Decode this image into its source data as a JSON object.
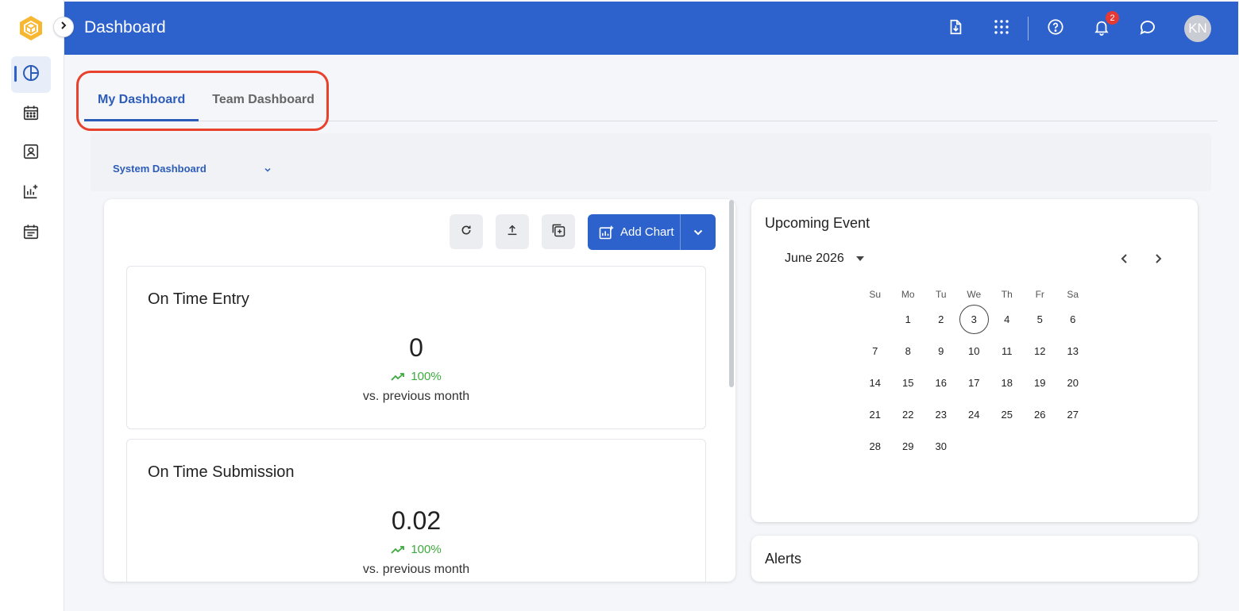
{
  "header": {
    "title": "Dashboard",
    "notification_count": "2",
    "avatar_initials": "KN",
    "color": "#2d62cc"
  },
  "sidebar": {
    "items": [
      {
        "icon": "dashboard-pie-icon",
        "active": true
      },
      {
        "icon": "calendar-icon",
        "active": false
      },
      {
        "icon": "user-card-icon",
        "active": false
      },
      {
        "icon": "chart-add-icon",
        "active": false
      },
      {
        "icon": "schedule-icon",
        "active": false
      }
    ]
  },
  "tabs": [
    {
      "label": "My Dashboard",
      "active": true
    },
    {
      "label": "Team Dashboard",
      "active": false
    }
  ],
  "dashboard_selector": {
    "value": "System Dashboard"
  },
  "toolbar": {
    "add_chart_label": "Add Chart"
  },
  "metrics": [
    {
      "title": "On Time Entry",
      "value": "0",
      "trend": "100%",
      "compare": "vs. previous month"
    },
    {
      "title": "On Time Submission",
      "value": "0.02",
      "trend": "100%",
      "compare": "vs. previous month"
    }
  ],
  "upcoming_event": {
    "title": "Upcoming Event",
    "month": "June 2026",
    "weekdays": [
      "Su",
      "Mo",
      "Tu",
      "We",
      "Th",
      "Fr",
      "Sa"
    ],
    "days": [
      "",
      "1",
      "2",
      "3",
      "4",
      "5",
      "6",
      "7",
      "8",
      "9",
      "10",
      "11",
      "12",
      "13",
      "14",
      "15",
      "16",
      "17",
      "18",
      "19",
      "20",
      "21",
      "22",
      "23",
      "24",
      "25",
      "26",
      "27",
      "28",
      "29",
      "30"
    ],
    "today": "3"
  },
  "alerts": {
    "title": "Alerts"
  }
}
